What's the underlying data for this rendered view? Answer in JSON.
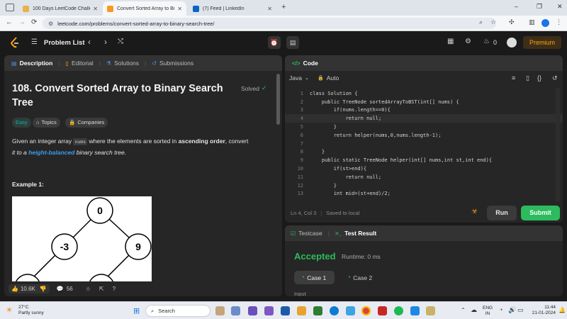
{
  "browser": {
    "tabs": [
      {
        "title": "100 Days LeetCode Challenge",
        "color": "#e8b24a"
      },
      {
        "title": "Convert Sorted Array to Binary",
        "color": "#f59a23"
      },
      {
        "title": "(7) Feed | LinkedIn",
        "color": "#0a66c2"
      }
    ],
    "url": "leetcode.com/problems/convert-sorted-array-to-binary-search-tree/",
    "window_minimize": "–",
    "window_maximize": "❐",
    "window_close": "✕",
    "new_tab": "+"
  },
  "lc_header": {
    "problem_list": "Problem List",
    "streak": "0",
    "premium": "Premium"
  },
  "description": {
    "tabs": [
      "Description",
      "Editorial",
      "Solutions",
      "Submissions"
    ],
    "title_line1": "108. Convert Sorted Array to Binary Search",
    "title_line2": "Tree",
    "solved": "Solved",
    "difficulty": "Easy",
    "topics": "Topics",
    "companies": "Companies",
    "text_part1": "Given an integer array ",
    "code_word": "nums",
    "text_part2": " where the elements are sorted in ",
    "bold_word": "ascending order",
    "text_part3": ", convert",
    "text_part4": "it to a ",
    "link_word": "height-balanced",
    "text_part5": " binary search tree.",
    "example_label": "Example 1:",
    "tree_nodes": [
      "0",
      "-3",
      "9"
    ],
    "likes": "10.6K",
    "comments": "56"
  },
  "editor": {
    "title": "Code",
    "language": "Java",
    "mode": "Auto",
    "lines": [
      {
        "n": "1",
        "t": "class Solution {"
      },
      {
        "n": "2",
        "t": "    public TreeNode sortedArrayToBST(int[] nums) {"
      },
      {
        "n": "3",
        "t": "        if(nums.length==0){"
      },
      {
        "n": "4",
        "t": "            return null;"
      },
      {
        "n": "5",
        "t": "        }"
      },
      {
        "n": "6",
        "t": "        return helper(nums,0,nums.length-1);"
      },
      {
        "n": "7",
        "t": ""
      },
      {
        "n": "8",
        "t": "    }"
      },
      {
        "n": "9",
        "t": "    public static TreeNode helper(int[] nums,int st,int end){"
      },
      {
        "n": "10",
        "t": "        if(st>end){"
      },
      {
        "n": "11",
        "t": "            return null;"
      },
      {
        "n": "12",
        "t": "        }"
      },
      {
        "n": "13",
        "t": "        int mid=(st+end)/2;"
      }
    ],
    "status_pos": "Ln 4, Col 3",
    "status_saved": "Saved to local",
    "run": "Run",
    "submit": "Submit"
  },
  "result": {
    "tab_testcase": "Testcase",
    "tab_result": "Test Result",
    "verdict": "Accepted",
    "runtime": "Runtime: 0 ms",
    "case1": "Case 1",
    "case2": "Case 2",
    "input_label": "Input"
  },
  "taskbar": {
    "temp": "27°C",
    "weather": "Partly sunny",
    "search": "Search",
    "lang1": "ENG",
    "lang2": "IN",
    "time": "11:44",
    "date": "21-01-2024"
  },
  "colors": {
    "accent_green": "#2cbb5d",
    "easy": "#00b8a3",
    "premium": "#ffa116"
  }
}
